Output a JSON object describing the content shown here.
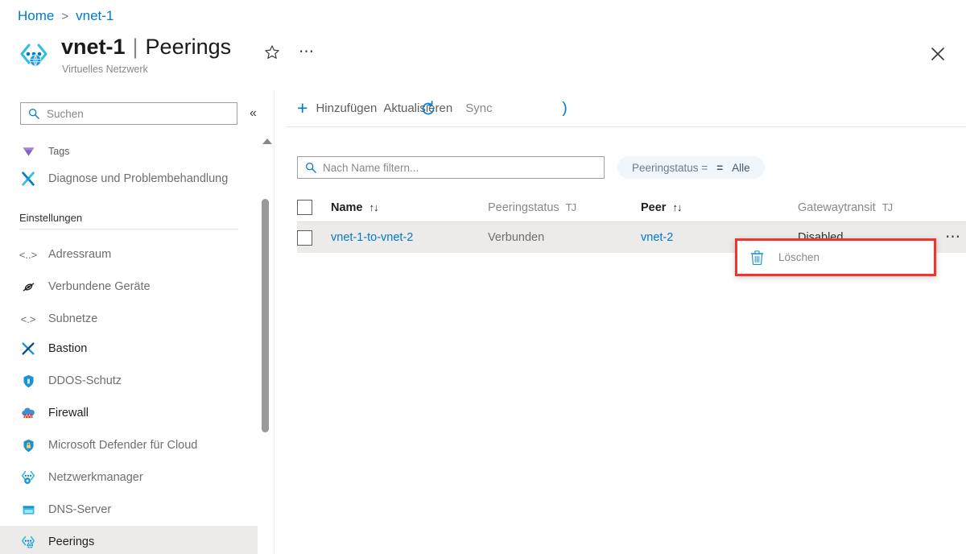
{
  "breadcrumb": {
    "home": "Home",
    "separator": ">",
    "current": "vnet-1"
  },
  "header": {
    "resource_name": "vnet-1",
    "separator": "|",
    "page": "Peerings",
    "caption": "Virtuelles Netzwerk",
    "favorite_icon": "star-icon",
    "more_icon": "ellipsis-icon",
    "close_icon": "close-icon"
  },
  "sidebar": {
    "search": {
      "placeholder": "Suchen",
      "icon": "search-icon"
    },
    "collapse_icon": "chevron-double-left-icon",
    "section_label": "Einstellungen",
    "items": [
      {
        "label": "Tags",
        "icon": "tag-icon",
        "selected": false
      },
      {
        "label": "Diagnose und Problembehandlung",
        "icon": "wrench-screwdriver-icon",
        "selected": false
      },
      {
        "label": "Adressraum",
        "icon": "placeholder-icon",
        "icon_text": "<..>",
        "selected": false
      },
      {
        "label": "Verbundene Geräte",
        "icon": "connected-devices-icon",
        "selected": false
      },
      {
        "label": "Subnetze",
        "icon": "placeholder-icon",
        "icon_text": "<.>",
        "selected": false
      },
      {
        "label": "Bastion",
        "icon": "bastion-icon",
        "selected": false
      },
      {
        "label": "DDOS-Schutz",
        "icon": "shield-icon",
        "selected": false
      },
      {
        "label": "Firewall",
        "icon": "firewall-cloud-icon",
        "selected": false
      },
      {
        "label": "Microsoft Defender für Cloud",
        "icon": "shield-lock-icon",
        "selected": false
      },
      {
        "label": "Netzwerkmanager",
        "icon": "network-manager-gear-icon",
        "selected": false
      },
      {
        "label": "DNS-Server",
        "icon": "dns-server-icon",
        "selected": false
      },
      {
        "label": "Peerings",
        "icon": "peering-icon",
        "selected": true
      }
    ],
    "scrollbar": {
      "up_arrow_icon": "scroll-up-arrow-icon",
      "thumb": "scrollbar-thumb"
    }
  },
  "toolbar": {
    "add_label": "Hinzufügen",
    "add_icon": "plus-icon",
    "refresh_label": "Aktualisieren",
    "refresh_icon": "refresh-icon",
    "sync_label": "Sync"
  },
  "filters": {
    "name_filter": {
      "placeholder": "Nach Name filtern...",
      "icon": "search-icon"
    },
    "status_pill": {
      "key": "Peeringstatus =",
      "operator": "=",
      "value": "Alle"
    }
  },
  "table": {
    "select_all_checkbox": "select-all-checkbox",
    "columns": [
      {
        "label": "Name",
        "sort": "↑↓",
        "emphasis": "bold"
      },
      {
        "label": "Peeringstatus",
        "sort": "TJ",
        "emphasis": "dim"
      },
      {
        "label": "Peer",
        "sort": "↑↓",
        "emphasis": "bold"
      },
      {
        "label": "Gatewaytransit",
        "sort": "TJ",
        "emphasis": "dim"
      }
    ],
    "rows": [
      {
        "name": "vnet-1-to-vnet-2",
        "status": "Verbunden",
        "peer": "vnet-2",
        "gateway_transit": "Disabled",
        "row_menu_icon": "ellipsis-icon"
      }
    ]
  },
  "context_menu": {
    "highlight_color": "#f0352c",
    "items": [
      {
        "label": "Löschen",
        "icon": "trash-icon"
      }
    ]
  }
}
